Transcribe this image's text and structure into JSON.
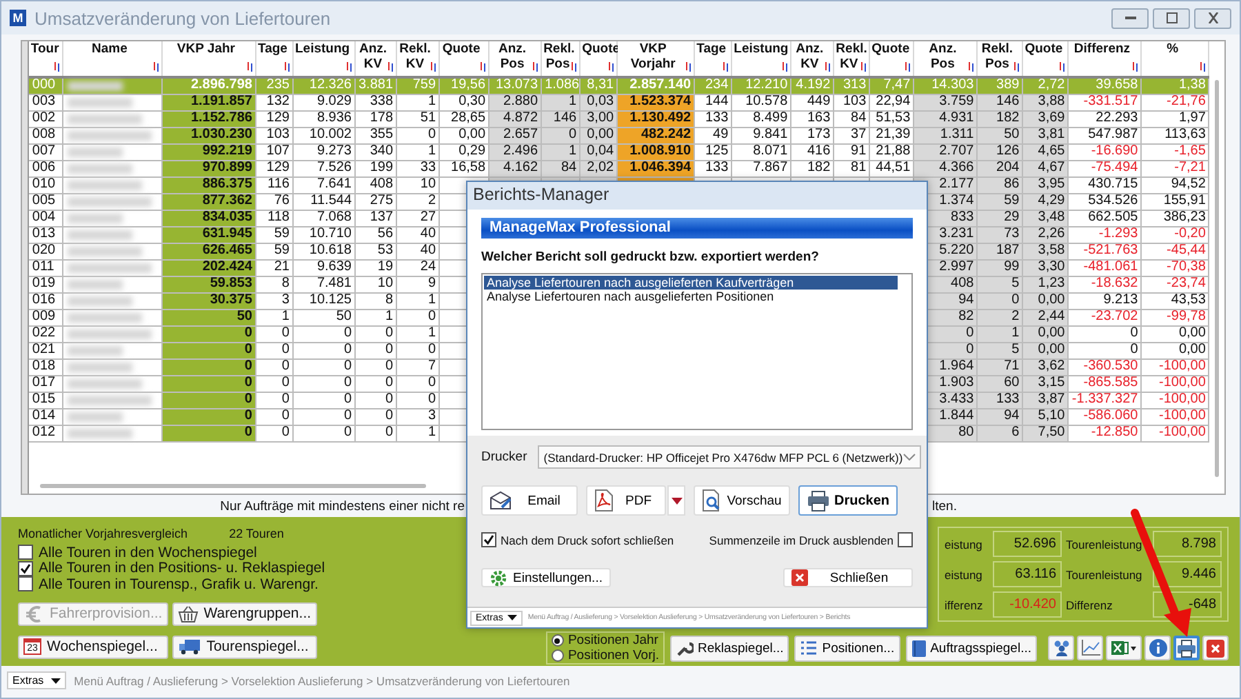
{
  "window": {
    "app_icon": "M",
    "title": "Umsatzveränderung von Liefertouren"
  },
  "table": {
    "columns": [
      {
        "label": "Tour",
        "kind": "id"
      },
      {
        "label": "Name",
        "kind": "name"
      },
      {
        "label": "VKP Jahr",
        "kind": "primary"
      },
      {
        "label": "Tage",
        "kind": "number"
      },
      {
        "label": "Leistung",
        "kind": "number"
      },
      {
        "label": "Anz. KV",
        "kind": "number"
      },
      {
        "label": "Rekl. KV",
        "kind": "number"
      },
      {
        "label": "Quote",
        "kind": "number"
      },
      {
        "label": "Anz. Pos",
        "kind": "shaded"
      },
      {
        "label": "Rekl. Pos",
        "kind": "shaded"
      },
      {
        "label": "Quote",
        "kind": "shaded"
      },
      {
        "label": "VKP Vorjahr",
        "kind": "previous"
      },
      {
        "label": "Tage",
        "kind": "number"
      },
      {
        "label": "Leistung",
        "kind": "number"
      },
      {
        "label": "Anz. KV",
        "kind": "number"
      },
      {
        "label": "Rekl. KV",
        "kind": "number"
      },
      {
        "label": "Quote",
        "kind": "number"
      },
      {
        "label": "Anz. Pos",
        "kind": "shaded"
      },
      {
        "label": "Rekl. Pos",
        "kind": "shaded"
      },
      {
        "label": "Quote",
        "kind": "shaded"
      },
      {
        "label": "Differenz",
        "kind": "change"
      },
      {
        "label": "%",
        "kind": "change"
      }
    ],
    "rows": [
      {
        "selected": true,
        "decline": false,
        "cells": [
          "000",
          null,
          "2.896.798",
          "235",
          "12.326",
          "3.881",
          "759",
          "19,56",
          "13.073",
          "1.086",
          "8,31",
          "2.857.140",
          "234",
          "12.210",
          "4.192",
          "313",
          "7,47",
          "14.303",
          "389",
          "2,72",
          "39.658",
          "1,38"
        ]
      },
      {
        "selected": false,
        "decline": true,
        "cells": [
          "003",
          null,
          "1.191.857",
          "132",
          "9.029",
          "338",
          "1",
          "0,30",
          "2.880",
          "1",
          "0,03",
          "1.523.374",
          "144",
          "10.578",
          "449",
          "103",
          "22,94",
          "3.759",
          "146",
          "3,88",
          "-331.517",
          "-21,76"
        ]
      },
      {
        "selected": false,
        "decline": false,
        "cells": [
          "002",
          null,
          "1.152.786",
          "129",
          "8.936",
          "178",
          "51",
          "28,65",
          "4.872",
          "146",
          "3,00",
          "1.130.492",
          "133",
          "8.499",
          "163",
          "84",
          "51,53",
          "4.931",
          "182",
          "3,69",
          "22.293",
          "1,97"
        ]
      },
      {
        "selected": false,
        "decline": false,
        "cells": [
          "008",
          null,
          "1.030.230",
          "103",
          "10.002",
          "355",
          "0",
          "0,00",
          "2.657",
          "0",
          "0,00",
          "482.242",
          "49",
          "9.841",
          "173",
          "37",
          "21,39",
          "1.311",
          "50",
          "3,81",
          "547.987",
          "113,63"
        ]
      },
      {
        "selected": false,
        "decline": true,
        "cells": [
          "007",
          null,
          "992.219",
          "107",
          "9.273",
          "340",
          "1",
          "0,29",
          "2.496",
          "1",
          "0,04",
          "1.008.910",
          "125",
          "8.071",
          "416",
          "91",
          "21,88",
          "2.707",
          "126",
          "4,65",
          "-16.690",
          "-1,65"
        ]
      },
      {
        "selected": false,
        "decline": true,
        "cells": [
          "006",
          null,
          "970.899",
          "129",
          "7.526",
          "199",
          "33",
          "16,58",
          "4.162",
          "84",
          "2,02",
          "1.046.394",
          "133",
          "7.867",
          "182",
          "81",
          "44,51",
          "4.366",
          "204",
          "4,67",
          "-75.494",
          "-7,21"
        ]
      },
      {
        "selected": false,
        "decline": false,
        "cells": [
          "010",
          null,
          "886.375",
          "116",
          "7.641",
          "408",
          "10",
          null,
          null,
          null,
          null,
          null,
          null,
          null,
          null,
          null,
          null,
          "2.177",
          "86",
          "3,95",
          "430.715",
          "94,52"
        ]
      },
      {
        "selected": false,
        "decline": false,
        "cells": [
          "005",
          null,
          "877.362",
          "76",
          "11.544",
          "275",
          "2",
          null,
          null,
          null,
          null,
          null,
          null,
          null,
          null,
          null,
          null,
          "1.374",
          "59",
          "4,29",
          "534.526",
          "155,91"
        ]
      },
      {
        "selected": false,
        "decline": false,
        "cells": [
          "004",
          null,
          "834.035",
          "118",
          "7.068",
          "137",
          "27",
          null,
          null,
          null,
          null,
          null,
          null,
          null,
          null,
          null,
          null,
          "833",
          "29",
          "3,48",
          "662.505",
          "386,23"
        ]
      },
      {
        "selected": false,
        "decline": true,
        "cells": [
          "013",
          null,
          "631.945",
          "59",
          "10.710",
          "56",
          "40",
          null,
          null,
          null,
          null,
          null,
          null,
          null,
          null,
          null,
          null,
          "3.231",
          "73",
          "2,26",
          "-1.293",
          "-0,20"
        ]
      },
      {
        "selected": false,
        "decline": true,
        "cells": [
          "020",
          null,
          "626.465",
          "59",
          "10.618",
          "53",
          "40",
          null,
          null,
          null,
          null,
          null,
          null,
          null,
          null,
          null,
          null,
          "5.220",
          "187",
          "3,58",
          "-521.763",
          "-45,44"
        ]
      },
      {
        "selected": false,
        "decline": true,
        "cells": [
          "011",
          null,
          "202.424",
          "21",
          "9.639",
          "19",
          "24",
          null,
          null,
          null,
          null,
          null,
          null,
          null,
          null,
          null,
          null,
          "2.997",
          "99",
          "3,30",
          "-481.061",
          "-70,38"
        ]
      },
      {
        "selected": false,
        "decline": true,
        "cells": [
          "019",
          null,
          "59.853",
          "8",
          "7.481",
          "10",
          "9",
          null,
          null,
          null,
          null,
          null,
          null,
          null,
          null,
          null,
          null,
          "408",
          "5",
          "1,23",
          "-18.632",
          "-23,74"
        ]
      },
      {
        "selected": false,
        "decline": false,
        "cells": [
          "016",
          null,
          "30.375",
          "3",
          "10.125",
          "8",
          "1",
          null,
          null,
          null,
          null,
          null,
          null,
          null,
          null,
          null,
          null,
          "94",
          "0",
          "0,00",
          "9.213",
          "43,53"
        ]
      },
      {
        "selected": false,
        "decline": true,
        "cells": [
          "009",
          null,
          "50",
          "1",
          "50",
          "1",
          "0",
          null,
          null,
          null,
          null,
          null,
          null,
          null,
          null,
          null,
          null,
          "82",
          "2",
          "2,44",
          "-23.702",
          "-99,78"
        ]
      },
      {
        "selected": false,
        "decline": false,
        "cells": [
          "022",
          null,
          "0",
          "0",
          "0",
          "0",
          "1",
          null,
          null,
          null,
          null,
          null,
          null,
          null,
          null,
          null,
          null,
          "0",
          "1",
          "0,00",
          "0",
          "0,00"
        ]
      },
      {
        "selected": false,
        "decline": false,
        "cells": [
          "021",
          null,
          "0",
          "0",
          "0",
          "0",
          "0",
          null,
          null,
          null,
          null,
          null,
          null,
          null,
          null,
          null,
          null,
          "0",
          "5",
          "0,00",
          "0",
          "0,00"
        ]
      },
      {
        "selected": false,
        "decline": true,
        "cells": [
          "018",
          null,
          "0",
          "0",
          "0",
          "0",
          "7",
          null,
          null,
          null,
          null,
          null,
          null,
          null,
          null,
          null,
          null,
          "1.964",
          "71",
          "3,62",
          "-360.530",
          "-100,00"
        ]
      },
      {
        "selected": false,
        "decline": true,
        "cells": [
          "017",
          null,
          "0",
          "0",
          "0",
          "0",
          "0",
          null,
          null,
          null,
          null,
          null,
          null,
          null,
          null,
          null,
          null,
          "1.903",
          "60",
          "3,15",
          "-865.585",
          "-100,00"
        ]
      },
      {
        "selected": false,
        "decline": true,
        "cells": [
          "015",
          null,
          "0",
          "0",
          "0",
          "0",
          "0",
          null,
          null,
          null,
          null,
          null,
          null,
          null,
          null,
          null,
          null,
          "3.433",
          "133",
          "3,87",
          "-1.337.327",
          "-100,00"
        ]
      },
      {
        "selected": false,
        "decline": true,
        "cells": [
          "014",
          null,
          "0",
          "0",
          "0",
          "0",
          "3",
          null,
          null,
          null,
          null,
          null,
          null,
          null,
          null,
          null,
          null,
          "1.844",
          "94",
          "5,10",
          "-586.060",
          "-100,00"
        ]
      },
      {
        "selected": false,
        "decline": true,
        "cells": [
          "012",
          null,
          "0",
          "0",
          "0",
          "0",
          "1",
          null,
          null,
          null,
          null,
          null,
          null,
          null,
          null,
          null,
          null,
          "80",
          "6",
          "7,50",
          "-12.850",
          "-100,00"
        ]
      }
    ]
  },
  "notice_start": "Nur Aufträge mit mindestens einer nicht re",
  "notice_end": "lten.",
  "panel": {
    "comparison_title": "Monatlicher Vorjahresvergleich",
    "tour_count": "22 Touren",
    "checkboxes": [
      {
        "label": "Alle Touren in den Wochenspiegel",
        "checked": false
      },
      {
        "label": "Alle Touren in den Positions- u. Reklaspiegel",
        "checked": true
      },
      {
        "label": "Alle Touren in Tourensp., Grafik u. Warengr.",
        "checked": false
      }
    ],
    "buttons": [
      {
        "label": "Fahrerprovision...",
        "disabled": true
      },
      {
        "label": "Warengruppen...",
        "disabled": false
      },
      {
        "label": "Wochenspiegel...",
        "icon_label": "23",
        "disabled": false
      },
      {
        "label": "Tourenspiegel...",
        "disabled": false
      }
    ],
    "stats": [
      {
        "cells": [
          {
            "label": "eistung",
            "value": "52.696",
            "negative": false
          },
          {
            "label": "Tourenleistung",
            "value": "8.798",
            "negative": false
          }
        ]
      },
      {
        "cells": [
          {
            "label": "eistung",
            "value": "63.116",
            "negative": false
          },
          {
            "label": "Tourenleistung",
            "value": "9.446",
            "negative": false
          }
        ]
      },
      {
        "cells": [
          {
            "label": "ifferenz",
            "value": "-10.420",
            "negative": true
          },
          {
            "label": "Differenz",
            "value": "-648",
            "negative": false
          }
        ]
      }
    ],
    "radios": [
      {
        "label": "Positionen Jahr",
        "selected": true
      },
      {
        "label": "Positionen Vorj.",
        "selected": false
      }
    ],
    "tool_buttons": [
      {
        "label": "Reklaspiegel..."
      },
      {
        "label": "Positionen..."
      },
      {
        "label": "Auftragsspiegel..."
      }
    ],
    "icon_buttons": [
      {
        "kind": "people",
        "selected": false
      },
      {
        "kind": "chart",
        "selected": false
      },
      {
        "kind": "excel",
        "selected": false
      },
      {
        "kind": "info",
        "selected": false
      },
      {
        "kind": "print",
        "selected": true
      },
      {
        "kind": "close",
        "selected": false
      }
    ]
  },
  "status_bar": {
    "menu": "Extras",
    "breadcrumb": "Menü Auftrag / Auslieferung > Vorselektion Auslieferung > Umsatzveränderung von Liefertouren"
  },
  "dialog": {
    "title": "Berichts-Manager",
    "banner": "ManageMax Professional",
    "question": "Welcher Bericht soll gedruckt bzw. exportiert werden?",
    "reports": [
      {
        "label": "Analyse Liefertouren nach ausgelieferten Kaufverträgen",
        "selected": true
      },
      {
        "label": "Analyse Liefertouren nach ausgelieferten Positionen",
        "selected": false
      }
    ],
    "printer_label": "Drucker",
    "printer": "(Standard-Drucker: HP Officejet Pro X476dw MFP PCL 6 (Netzwerk))",
    "actions": [
      {
        "label": "Email",
        "selected": false
      },
      {
        "label": "PDF",
        "selected": false
      },
      {
        "label": "Vorschau",
        "selected": false
      },
      {
        "label": "Drucken",
        "selected": true
      }
    ],
    "close_after_print": {
      "label": "Nach dem Druck sofort schließen",
      "checked": true
    },
    "hide_total": {
      "label": "Summenzeile im Druck ausblenden",
      "checked": false
    },
    "settings_button": "Einstellungen...",
    "close_button": "Schließen",
    "status_bar": {
      "menu": "Extras",
      "breadcrumb": "Menü Auftrag / Auslieferung > Vorselektion Auslieferung > Umsatzveränderung von Liefertouren > Berichts"
    }
  }
}
